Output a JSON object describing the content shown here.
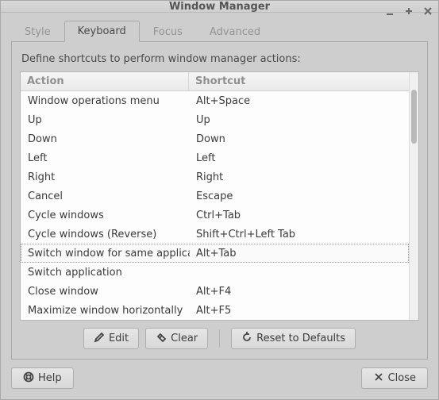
{
  "window": {
    "title": "Window Manager"
  },
  "tabs": [
    {
      "id": "style",
      "label": "Style",
      "active": false
    },
    {
      "id": "keyboard",
      "label": "Keyboard",
      "active": true
    },
    {
      "id": "focus",
      "label": "Focus",
      "active": false
    },
    {
      "id": "advanced",
      "label": "Advanced",
      "active": false
    }
  ],
  "panel": {
    "description": "Define shortcuts to perform window manager actions:",
    "columns": {
      "action": "Action",
      "shortcut": "Shortcut"
    },
    "rows": [
      {
        "action": "Window operations menu",
        "shortcut": "Alt+Space",
        "selected": false
      },
      {
        "action": "Up",
        "shortcut": "Up",
        "selected": false
      },
      {
        "action": "Down",
        "shortcut": "Down",
        "selected": false
      },
      {
        "action": "Left",
        "shortcut": "Left",
        "selected": false
      },
      {
        "action": "Right",
        "shortcut": "Right",
        "selected": false
      },
      {
        "action": "Cancel",
        "shortcut": "Escape",
        "selected": false
      },
      {
        "action": "Cycle windows",
        "shortcut": "Ctrl+Tab",
        "selected": false
      },
      {
        "action": "Cycle windows (Reverse)",
        "shortcut": "Shift+Ctrl+Left Tab",
        "selected": false
      },
      {
        "action": "Switch window for same application",
        "shortcut": "Alt+Tab",
        "selected": true
      },
      {
        "action": "Switch application",
        "shortcut": "",
        "selected": false
      },
      {
        "action": "Close window",
        "shortcut": "Alt+F4",
        "selected": false
      },
      {
        "action": "Maximize window horizontally",
        "shortcut": "Alt+F5",
        "selected": false
      }
    ],
    "buttons": {
      "edit": "Edit",
      "clear": "Clear",
      "reset": "Reset to Defaults"
    }
  },
  "footer": {
    "help": "Help",
    "close": "Close"
  }
}
